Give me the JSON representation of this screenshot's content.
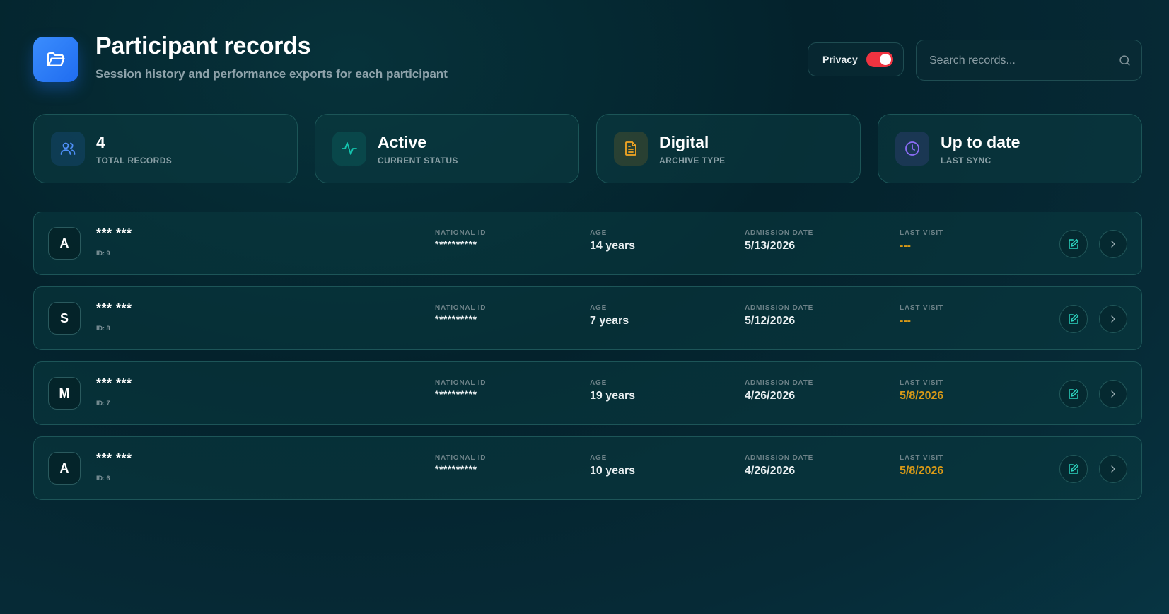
{
  "header": {
    "title": "Participant records",
    "subtitle": "Session history and performance exports for each participant",
    "logo_icon": "folder-open-icon"
  },
  "privacy": {
    "label": "Privacy",
    "enabled": true,
    "toggle_color": "#ef3340"
  },
  "search": {
    "placeholder": "Search records...",
    "value": "",
    "icon": "search-icon"
  },
  "stats": [
    {
      "value": "4",
      "label": "TOTAL RECORDS",
      "icon": "users-icon",
      "color": "#3b82f6"
    },
    {
      "value": "Active",
      "label": "CURRENT STATUS",
      "icon": "activity-icon",
      "color": "#14b8a6"
    },
    {
      "value": "Digital",
      "label": "ARCHIVE TYPE",
      "icon": "document-icon",
      "color": "#f59e0b"
    },
    {
      "value": "Up to date",
      "label": "LAST SYNC",
      "icon": "clock-icon",
      "color": "#8b5cf6"
    }
  ],
  "columns": {
    "national_id": "NATIONAL ID",
    "age": "AGE",
    "admission": "ADMISSION DATE",
    "last_visit": "LAST VISIT"
  },
  "records": [
    {
      "initial": "A",
      "name": "*** ***",
      "id": "ID: 9",
      "national_id": "**********",
      "age": "14 years",
      "admission": "5/13/2026",
      "last_visit": "---"
    },
    {
      "initial": "S",
      "name": "*** ***",
      "id": "ID: 8",
      "national_id": "**********",
      "age": "7 years",
      "admission": "5/12/2026",
      "last_visit": "---"
    },
    {
      "initial": "M",
      "name": "*** ***",
      "id": "ID: 7",
      "national_id": "**********",
      "age": "19 years",
      "admission": "4/26/2026",
      "last_visit": "5/8/2026"
    },
    {
      "initial": "A",
      "name": "*** ***",
      "id": "ID: 6",
      "national_id": "**********",
      "age": "10 years",
      "admission": "4/26/2026",
      "last_visit": "5/8/2026"
    }
  ],
  "colors": {
    "accent_orange": "#d99a17",
    "action_teal": "#2dd4bf"
  }
}
